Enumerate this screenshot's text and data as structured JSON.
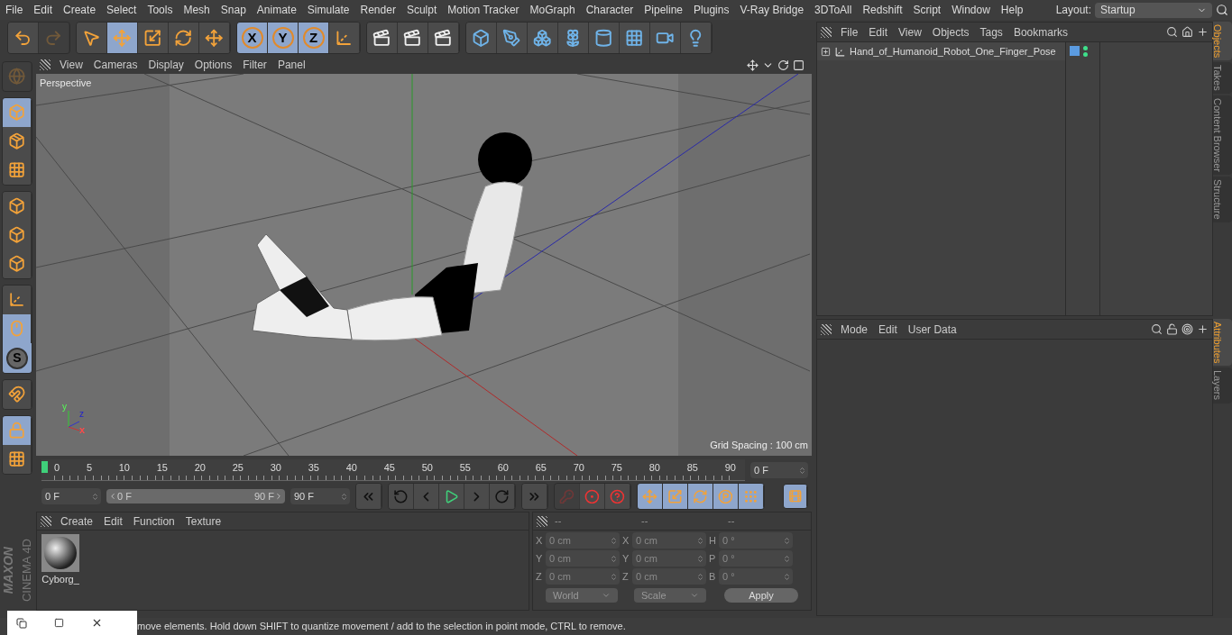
{
  "menu": {
    "items": [
      "File",
      "Edit",
      "Create",
      "Select",
      "Tools",
      "Mesh",
      "Snap",
      "Animate",
      "Simulate",
      "Render",
      "Sculpt",
      "Motion Tracker",
      "MoGraph",
      "Character",
      "Pipeline",
      "Plugins",
      "V-Ray Bridge",
      "3DToAll",
      "Redshift",
      "Script",
      "Window",
      "Help"
    ],
    "layout_label": "Layout:",
    "layout_value": "Startup"
  },
  "toolbar": {
    "groups": [
      [
        {
          "selected": false,
          "disabled": false
        },
        {
          "selected": false,
          "disabled": true
        }
      ],
      [
        {
          "selected": false,
          "disabled": false
        },
        {
          "selected": true,
          "disabled": false
        },
        {
          "selected": false,
          "disabled": false
        },
        {
          "selected": false,
          "disabled": false
        },
        {
          "selected": false,
          "disabled": false
        }
      ],
      [
        {
          "selected": true,
          "disabled": false,
          "label": "X"
        },
        {
          "selected": true,
          "disabled": false,
          "label": "Y"
        },
        {
          "selected": true,
          "disabled": false,
          "label": "Z"
        },
        {
          "selected": false,
          "disabled": false
        }
      ],
      [
        {
          "selected": false,
          "disabled": false
        },
        {
          "selected": false,
          "disabled": false
        },
        {
          "selected": false,
          "disabled": false
        }
      ],
      [
        {
          "selected": false,
          "disabled": false
        },
        {
          "selected": false,
          "disabled": false
        },
        {
          "selected": false,
          "disabled": false
        },
        {
          "selected": false,
          "disabled": false
        },
        {
          "selected": false,
          "disabled": false
        },
        {
          "selected": false,
          "disabled": false
        },
        {
          "selected": false,
          "disabled": false
        },
        {
          "selected": false,
          "disabled": false
        }
      ]
    ]
  },
  "left_tools": {
    "groups": [
      [
        {
          "selected": false,
          "disabled": true
        }
      ],
      [
        {
          "selected": true,
          "disabled": false
        },
        {
          "selected": false,
          "disabled": false
        },
        {
          "selected": false,
          "disabled": false
        }
      ],
      [
        {
          "selected": false,
          "disabled": false
        },
        {
          "selected": false,
          "disabled": false
        },
        {
          "selected": false,
          "disabled": false
        }
      ],
      [
        {
          "selected": false,
          "disabled": false
        },
        {
          "selected": true,
          "disabled": false
        },
        {
          "selected": true,
          "disabled": false,
          "label": "S"
        }
      ],
      [
        {
          "selected": false,
          "disabled": false
        }
      ],
      [
        {
          "selected": true,
          "disabled": false
        },
        {
          "selected": false,
          "disabled": false
        }
      ]
    ],
    "logo": [
      "MAXON",
      "CINEMA 4D"
    ]
  },
  "viewport": {
    "menu": [
      "View",
      "Cameras",
      "Display",
      "Options",
      "Filter",
      "Panel"
    ],
    "camera_label": "Perspective",
    "axis_labels": [
      "y",
      "z",
      "x"
    ],
    "grid_spacing": "Grid Spacing : 100 cm"
  },
  "timeline": {
    "ticks": [
      "0",
      "5",
      "10",
      "15",
      "20",
      "25",
      "30",
      "35",
      "40",
      "45",
      "50",
      "55",
      "60",
      "65",
      "70",
      "75",
      "80",
      "85",
      "90"
    ],
    "current_frame": "0 F"
  },
  "transport": {
    "start": "0 F",
    "range": {
      "start": "0 F",
      "end": "90 F",
      "level": 1
    },
    "end": "90 F",
    "buttons": [
      {
        "selected": false,
        "disabled": false
      },
      {
        "selected": false,
        "disabled": false
      },
      {
        "selected": false,
        "disabled": false
      },
      {
        "selected": false,
        "disabled": false
      },
      {
        "selected": false,
        "disabled": false
      },
      {
        "selected": false,
        "disabled": false
      },
      {
        "selected": false,
        "disabled": false
      }
    ],
    "record": [
      {
        "selected": false,
        "disabled": true
      },
      {
        "selected": false,
        "disabled": false
      },
      {
        "selected": false,
        "disabled": false
      }
    ],
    "key_filters": [
      {
        "selected": true,
        "disabled": false
      },
      {
        "selected": true,
        "disabled": false
      },
      {
        "selected": true,
        "disabled": false
      },
      {
        "selected": true,
        "disabled": false
      },
      {
        "selected": true,
        "disabled": false
      }
    ],
    "timeline_button": {
      "selected": true
    }
  },
  "materials": {
    "menu": [
      "Create",
      "Edit",
      "Function",
      "Texture"
    ],
    "items": [
      {
        "name": "Cyborg_"
      }
    ]
  },
  "coordinates": {
    "headers": [
      "--",
      "--",
      "--"
    ],
    "rows": [
      [
        {
          "label": "X",
          "value": "0 cm"
        },
        {
          "label": "X",
          "value": "0 cm"
        },
        {
          "label": "H",
          "value": "0 °"
        }
      ],
      [
        {
          "label": "Y",
          "value": "0 cm"
        },
        {
          "label": "Y",
          "value": "0 cm"
        },
        {
          "label": "P",
          "value": "0 °"
        }
      ],
      [
        {
          "label": "Z",
          "value": "0 cm"
        },
        {
          "label": "Z",
          "value": "0 cm"
        },
        {
          "label": "B",
          "value": "0 °"
        }
      ]
    ],
    "dropdowns": [
      "World",
      "Scale"
    ],
    "apply": "Apply"
  },
  "objects_panel": {
    "menu": [
      "File",
      "Edit",
      "View",
      "Objects",
      "Tags",
      "Bookmarks"
    ],
    "objects": [
      {
        "name": "Hand_of_Humanoid_Robot_One_Finger_Pose",
        "expanded": false
      }
    ]
  },
  "attributes_panel": {
    "menu": [
      "Mode",
      "Edit",
      "User Data"
    ]
  },
  "side_tabs_top": [
    {
      "label": "Objects",
      "selected": true
    },
    {
      "label": "Takes",
      "selected": false
    },
    {
      "label": "Content Browser",
      "selected": false
    },
    {
      "label": "Structure",
      "selected": false
    }
  ],
  "side_tabs_bottom": [
    {
      "label": "Attributes",
      "selected": true
    },
    {
      "label": "Layers",
      "selected": false
    }
  ],
  "status_bar": {
    "text": "move elements. Hold down SHIFT to quantize movement / add to the selection in point mode, CTRL to remove."
  }
}
